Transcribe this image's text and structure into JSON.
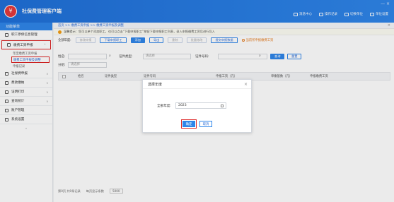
{
  "app": {
    "title": "社保费管理客户端",
    "logo_glyph": "¥"
  },
  "window_controls": "— ×",
  "top_menu": [
    {
      "label": "消息中心",
      "icon": "message-icon"
    },
    {
      "label": "操作记录",
      "icon": "record-icon"
    },
    {
      "label": "切换单位",
      "icon": "switch-icon"
    },
    {
      "label": "单位设置",
      "icon": "settings-icon"
    }
  ],
  "sidebar": {
    "header": "功能菜单",
    "items": [
      {
        "label": "职工参保信息管理",
        "icon": "person-icon",
        "expand": ""
      },
      {
        "label": "缴费工资申报",
        "icon": "wage-icon",
        "expand": "^",
        "active": true
      },
      {
        "label": "社保费申报",
        "icon": "declare-icon",
        "expand": "v"
      },
      {
        "label": "费款缴纳",
        "icon": "pay-icon",
        "expand": "v"
      },
      {
        "label": "证明打印",
        "icon": "print-icon",
        "expand": "v"
      },
      {
        "label": "查询统计",
        "icon": "stats-icon",
        "expand": "v"
      },
      {
        "label": "账户管理",
        "icon": "account-icon",
        "expand": ""
      },
      {
        "label": "系统设置",
        "icon": "gear-icon",
        "expand": ""
      }
    ],
    "subitems": [
      "年度缴费工资申报",
      "缴费工资申报及调整",
      "申报记录"
    ],
    "collapse": "«"
  },
  "breadcrumb": "首页 >> 缴费工资申报 >> 缴费工资申报及调整",
  "notice": "温馨提示：您可以单个添加职工，也可以点击“下载申报职工”按钮下载申报职工列表，录入申报缴费工资后进行导入",
  "toolbar": {
    "year_label": "全部年度:",
    "buttons": [
      "修改申报",
      "下载申报职工",
      "添加",
      "导出",
      "删除",
      "批量修改",
      "提交申报数据"
    ],
    "warn_link": "当前所申报缴费工资"
  },
  "filter": {
    "name_label": "姓名:",
    "id_type_label": "证件类型:",
    "id_type_placeholder": "请选择",
    "id_no_label": "证件号码:",
    "query_button": "查询",
    "reset_button": "重置",
    "group_label": "分组:",
    "group_placeholder": "请选择"
  },
  "table": {
    "headers": [
      "姓名",
      "证件类型",
      "证件号码",
      "",
      "",
      "申报工资（元）",
      "单缴基数（元）",
      "申报缴费工资"
    ]
  },
  "pager": {
    "summary": "第0页 共0条记录",
    "per_page_label": "每页显示条数",
    "per_page_value": "5000"
  },
  "dialog": {
    "title": "选择年度",
    "field_label": "全部年度:",
    "field_value": "2023",
    "ok": "确定",
    "cancel": "取消"
  }
}
